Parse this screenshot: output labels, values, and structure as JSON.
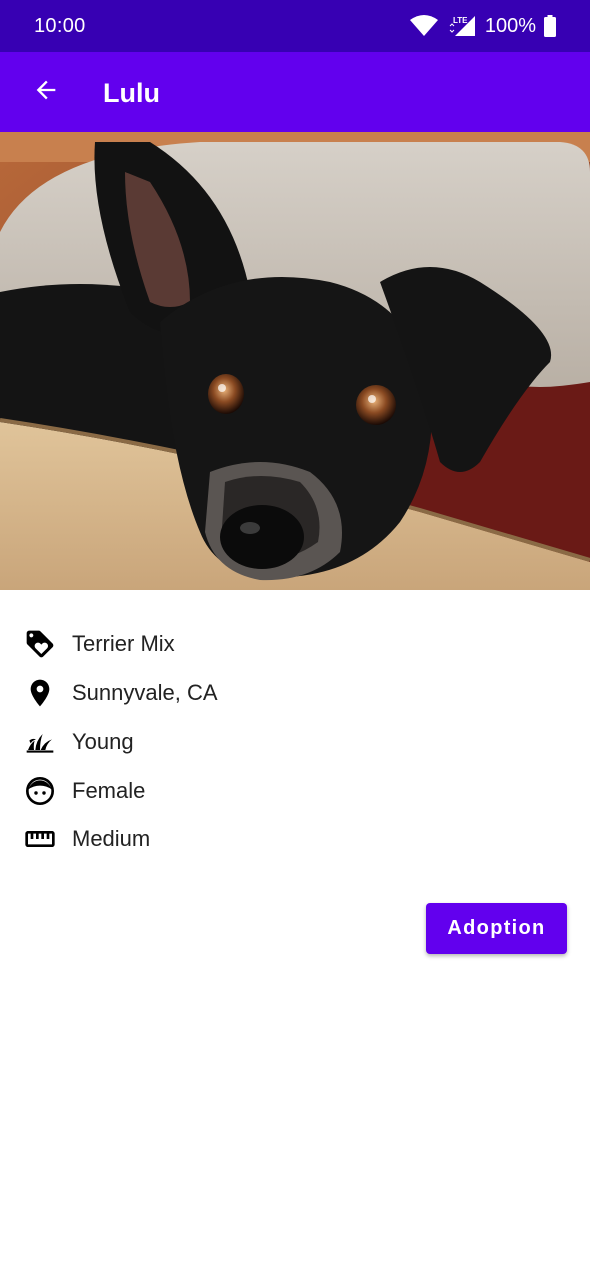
{
  "status_bar": {
    "time": "10:00",
    "network": "LTE",
    "battery": "100%",
    "icons": [
      "wifi-icon",
      "cell-signal-icon",
      "battery-icon"
    ]
  },
  "app_bar": {
    "title": "Lulu",
    "back_icon": "arrow-back-icon",
    "color": "#6200ee"
  },
  "photo": {
    "subject": "black dog resting head on a couch"
  },
  "details": [
    {
      "icon": "tag-icon",
      "label": "Terrier Mix"
    },
    {
      "icon": "location-pin-icon",
      "label": "Sunnyvale, CA"
    },
    {
      "icon": "sprout-icon",
      "label": "Young"
    },
    {
      "icon": "face-icon",
      "label": "Female"
    },
    {
      "icon": "ruler-icon",
      "label": "Medium"
    }
  ],
  "actions": {
    "adopt_label": "Adoption"
  },
  "colors": {
    "primary": "#6200ee",
    "primary_dark": "#3700b3"
  }
}
